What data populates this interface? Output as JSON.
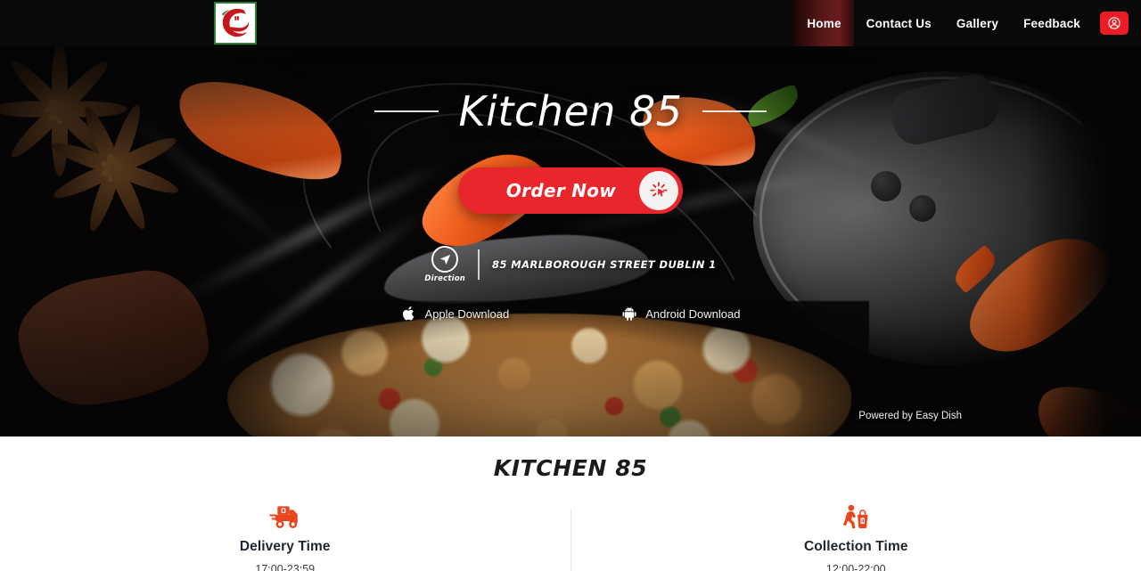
{
  "navbar": {
    "logo_alt": "kitchen-85-logo",
    "links": [
      {
        "label": "Home",
        "name": "nav-link-home",
        "active": true
      },
      {
        "label": "Contact Us",
        "name": "nav-link-contact-us",
        "active": false
      },
      {
        "label": "Gallery",
        "name": "nav-link-gallery",
        "active": false
      },
      {
        "label": "Feedback",
        "name": "nav-link-feedback",
        "active": false
      }
    ],
    "account_icon": "user-circle-icon",
    "background": "#0a0909",
    "active_accent": "#6b1c1c"
  },
  "hero": {
    "title": "Kitchen 85",
    "order_button": {
      "label": "Order Now",
      "icon": "click-cursor-icon",
      "color": "#e8262c"
    },
    "direction": {
      "label": "Direction",
      "icon": "navigation-arrow-icon"
    },
    "address": "85 MARLBOROUGH STREET DUBLIN 1",
    "downloads": [
      {
        "label": "Apple Download",
        "icon": "apple-icon",
        "name": "apple-download-link"
      },
      {
        "label": "Android Download",
        "icon": "android-icon",
        "name": "android-download-link"
      }
    ],
    "powered_by": "Powered by Easy Dish"
  },
  "info": {
    "heading": "KITCHEN 85",
    "accent": "#e0251c",
    "cards": [
      {
        "title": "Delivery Time",
        "time": "17:00-23:59",
        "icon": "delivery-truck-icon",
        "name": "delivery-time-card"
      },
      {
        "title": "Collection Time",
        "time": "12:00-22:00",
        "icon": "walking-pickup-icon",
        "name": "collection-time-card"
      }
    ]
  }
}
